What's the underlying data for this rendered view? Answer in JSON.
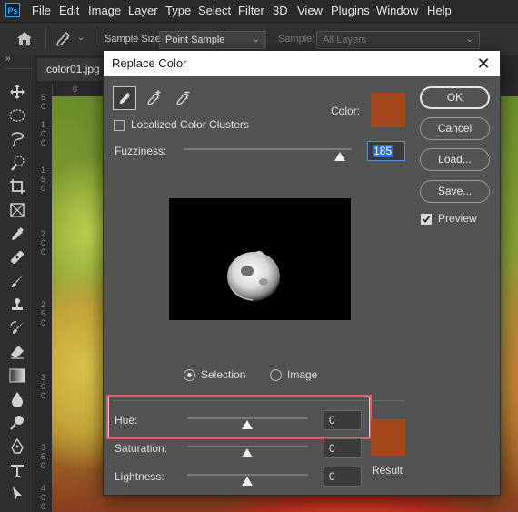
{
  "app": {
    "logo": "Ps",
    "menu": [
      "File",
      "Edit",
      "Image",
      "Layer",
      "Type",
      "Select",
      "Filter",
      "3D",
      "View",
      "Plugins",
      "Window",
      "Help"
    ]
  },
  "options_bar": {
    "sample_size_label": "Sample Size:",
    "sample_size_value": "Point Sample",
    "sample_label": "Sample:",
    "sample_value": "All Layers"
  },
  "document": {
    "tab_label": "color01.jpg",
    "ruler_top_numbers": [
      "0"
    ],
    "ruler_left_numbers": [
      "5",
      "0",
      "1",
      "0",
      "0",
      "1",
      "5",
      "0",
      "2",
      "0",
      "0",
      "2",
      "5",
      "0",
      "3",
      "0",
      "0",
      "3",
      "5",
      "0",
      "4",
      "0",
      "0"
    ]
  },
  "dialog": {
    "title": "Replace Color",
    "close_symbol": "✕",
    "localized_clusters_label": "Localized Color Clusters",
    "localized_clusters_checked": false,
    "color_label": "Color:",
    "color_swatch": "#a6461c",
    "fuzziness_label": "Fuzziness:",
    "fuzziness_value": "185",
    "fuzziness_level_percent": 93,
    "selection_label": "Selection",
    "image_label": "Image",
    "selected_view": "Selection",
    "hue_label": "Hue:",
    "hue_value": "0",
    "saturation_label": "Saturation:",
    "saturation_value": "0",
    "lightness_label": "Lightness:",
    "lightness_value": "0",
    "result_label": "Result",
    "result_swatch": "#a6461c",
    "buttons": {
      "ok": "OK",
      "cancel": "Cancel",
      "load": "Load...",
      "save": "Save..."
    },
    "preview_label": "Preview",
    "preview_checked": true,
    "highlight_color": "#e35b6e"
  }
}
